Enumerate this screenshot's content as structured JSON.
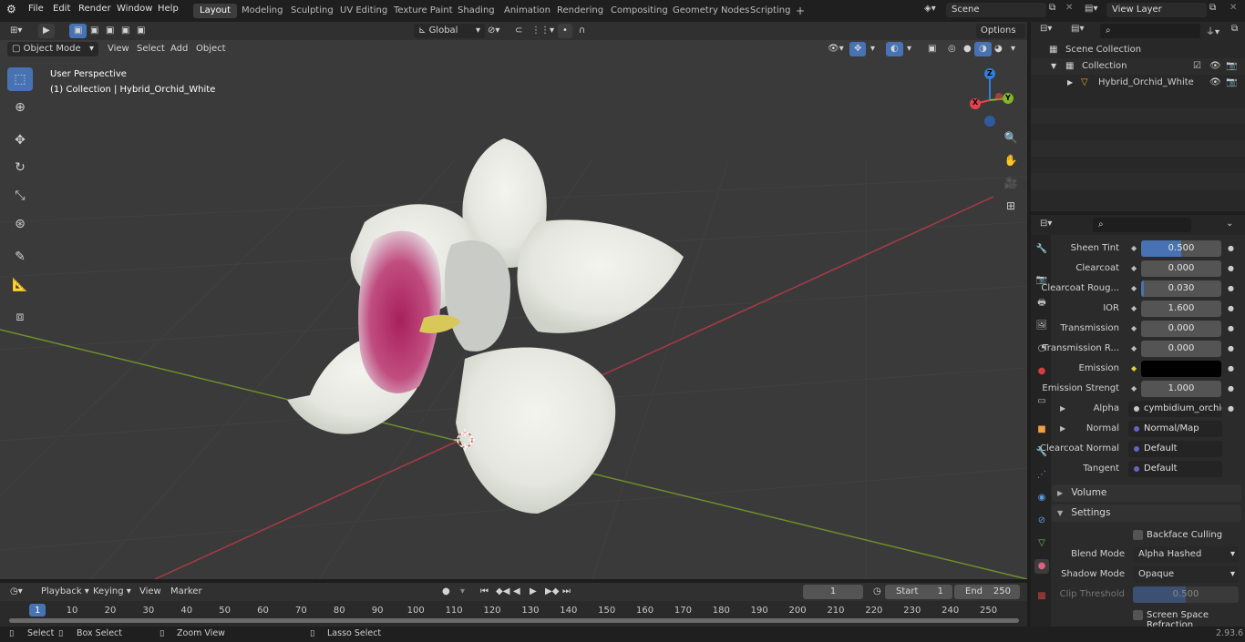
{
  "topbar": {
    "menus": [
      "File",
      "Edit",
      "Render",
      "Window",
      "Help"
    ],
    "workspaces": [
      "Layout",
      "Modeling",
      "Sculpting",
      "UV Editing",
      "Texture Paint",
      "Shading",
      "Animation",
      "Rendering",
      "Compositing",
      "Geometry Nodes",
      "Scripting"
    ],
    "active_workspace": "Layout",
    "add_workspace": "+",
    "scene": "Scene",
    "view_layer": "View Layer"
  },
  "viewport": {
    "mode": "Object Mode",
    "menus": [
      "View",
      "Select",
      "Add",
      "Object"
    ],
    "orientation": "Global",
    "options": "Options",
    "overlay_title": "User Perspective",
    "overlay_subtitle": "(1) Collection | Hybrid_Orchid_White",
    "gizmo": {
      "x": "X",
      "y": "Y",
      "z": "Z"
    },
    "colors": {
      "x_axis": "#e2434f",
      "y_axis": "#82b52a",
      "z_axis": "#2f7fe0"
    }
  },
  "outliner": {
    "items": [
      {
        "label": "Scene Collection"
      },
      {
        "label": "Collection"
      },
      {
        "label": "Hybrid_Orchid_White"
      }
    ]
  },
  "properties": {
    "rows": [
      {
        "label": "Sheen Tint",
        "value": "0.500",
        "fill": 0.5
      },
      {
        "label": "Clearcoat",
        "value": "0.000",
        "fill": 0.0
      },
      {
        "label": "Clearcoat Roug...",
        "value": "0.030",
        "fill": 0.03
      },
      {
        "label": "IOR",
        "value": "1.600",
        "fill": 0.0
      },
      {
        "label": "Transmission",
        "value": "0.000",
        "fill": 0.0
      },
      {
        "label": "Transmission R...",
        "value": "0.000",
        "fill": 0.0
      },
      {
        "label": "Emission",
        "value": "",
        "fill": 0.0
      },
      {
        "label": "Emission Strengt",
        "value": "1.000",
        "fill": 0.0
      }
    ],
    "sockets": [
      {
        "label": "Alpha",
        "value": "cymbidium_orchid_g...",
        "color": "#c6c6c6"
      },
      {
        "label": "Normal",
        "value": "Normal/Map",
        "color": "#6363c7"
      },
      {
        "label": "Clearcoat Normal",
        "value": "Default",
        "color": "#6363c7"
      },
      {
        "label": "Tangent",
        "value": "Default",
        "color": "#6363c7"
      }
    ],
    "panels": {
      "volume": "Volume",
      "settings": "Settings"
    },
    "settings": {
      "backface": "Backface Culling",
      "blend_label": "Blend Mode",
      "blend_value": "Alpha Hashed",
      "shadow_label": "Shadow Mode",
      "shadow_value": "Opaque",
      "clip_label": "Clip Threshold",
      "clip_value": "0.500",
      "ssr": "Screen Space Refraction"
    }
  },
  "timeline": {
    "menus": [
      "Playback",
      "Keying",
      "View",
      "Marker"
    ],
    "current_frame": "1",
    "start_label": "Start",
    "start": "1",
    "end_label": "End",
    "end": "250",
    "ticks": [
      "1",
      "10",
      "20",
      "30",
      "40",
      "50",
      "60",
      "70",
      "80",
      "90",
      "100",
      "110",
      "120",
      "130",
      "140",
      "150",
      "160",
      "170",
      "180",
      "190",
      "200",
      "210",
      "220",
      "230",
      "240",
      "250"
    ]
  },
  "statusbar": {
    "select": "Select",
    "box_select": "Box Select",
    "zoom": "Zoom View",
    "lasso": "Lasso Select",
    "version": "2.93.6"
  }
}
